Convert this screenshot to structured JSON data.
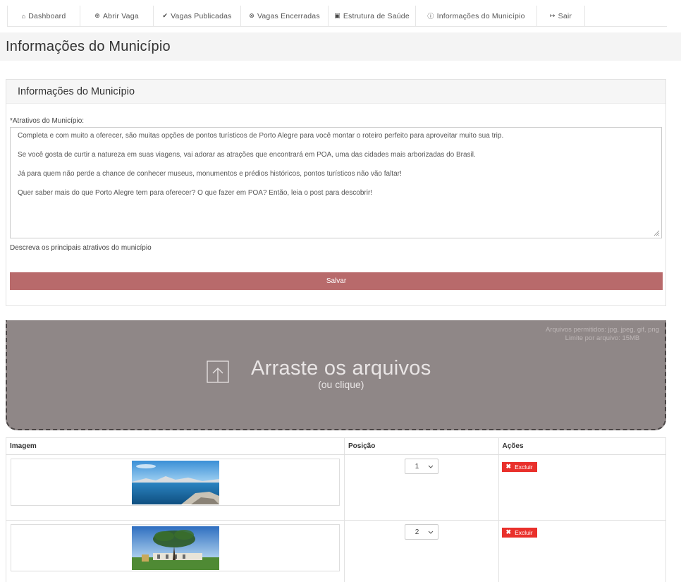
{
  "nav": {
    "items": [
      {
        "icon": "home-icon",
        "glyph": "⌂",
        "label": "Dashboard"
      },
      {
        "icon": "plus-circle-icon",
        "glyph": "⊕",
        "label": "Abrir Vaga"
      },
      {
        "icon": "check-circle-icon",
        "glyph": "✔",
        "label": "Vagas Publicadas"
      },
      {
        "icon": "x-circle-icon",
        "glyph": "⊗",
        "label": "Vagas Encerradas"
      },
      {
        "icon": "hospital-icon",
        "glyph": "▣",
        "label": "Estrutura de Saúde"
      },
      {
        "icon": "info-circle-icon",
        "glyph": "ⓘ",
        "label": "Informações do Município"
      },
      {
        "icon": "sign-out-icon",
        "glyph": "↦",
        "label": "Sair"
      }
    ]
  },
  "page": {
    "title": "Informações do Município"
  },
  "panel": {
    "heading": "Informações do Município",
    "field_label": "*Atrativos do Município:",
    "textarea_lines": [
      "Completa e com muito a oferecer, são muitas opções de pontos turísticos de Porto Alegre para você montar o roteiro perfeito para aproveitar muito sua trip.",
      "Se você gosta de curtir a natureza em suas viagens, vai adorar as atrações que encontrará em POA, uma das cidades mais arborizadas do Brasil.",
      "Já para quem não perde a chance de conhecer museus, monumentos e prédios históricos, pontos turísticos não vão faltar!",
      "Quer saber mais do que Porto Alegre tem para oferecer? O que fazer em POA? Então, leia o post para descobrir!"
    ],
    "help_text": "Descreva os principais atrativos do município",
    "save_label": "Salvar"
  },
  "dropzone": {
    "info_line1": "Arquivos permitidos: jpg, jpeg, gif, png",
    "info_line2": "Limite por arquivo: 15MB",
    "title": "Arraste os arquivos",
    "subtitle": "(ou clique)"
  },
  "table": {
    "headers": {
      "image": "Imagem",
      "position": "Posição",
      "actions": "Ações"
    },
    "rows": [
      {
        "position": "1",
        "delete_label": "Excluir"
      },
      {
        "position": "2",
        "delete_label": "Excluir"
      }
    ]
  },
  "colors": {
    "save_button": "#b86a6b",
    "dropzone_bg": "#8f8787",
    "delete_button": "#e9302b"
  }
}
